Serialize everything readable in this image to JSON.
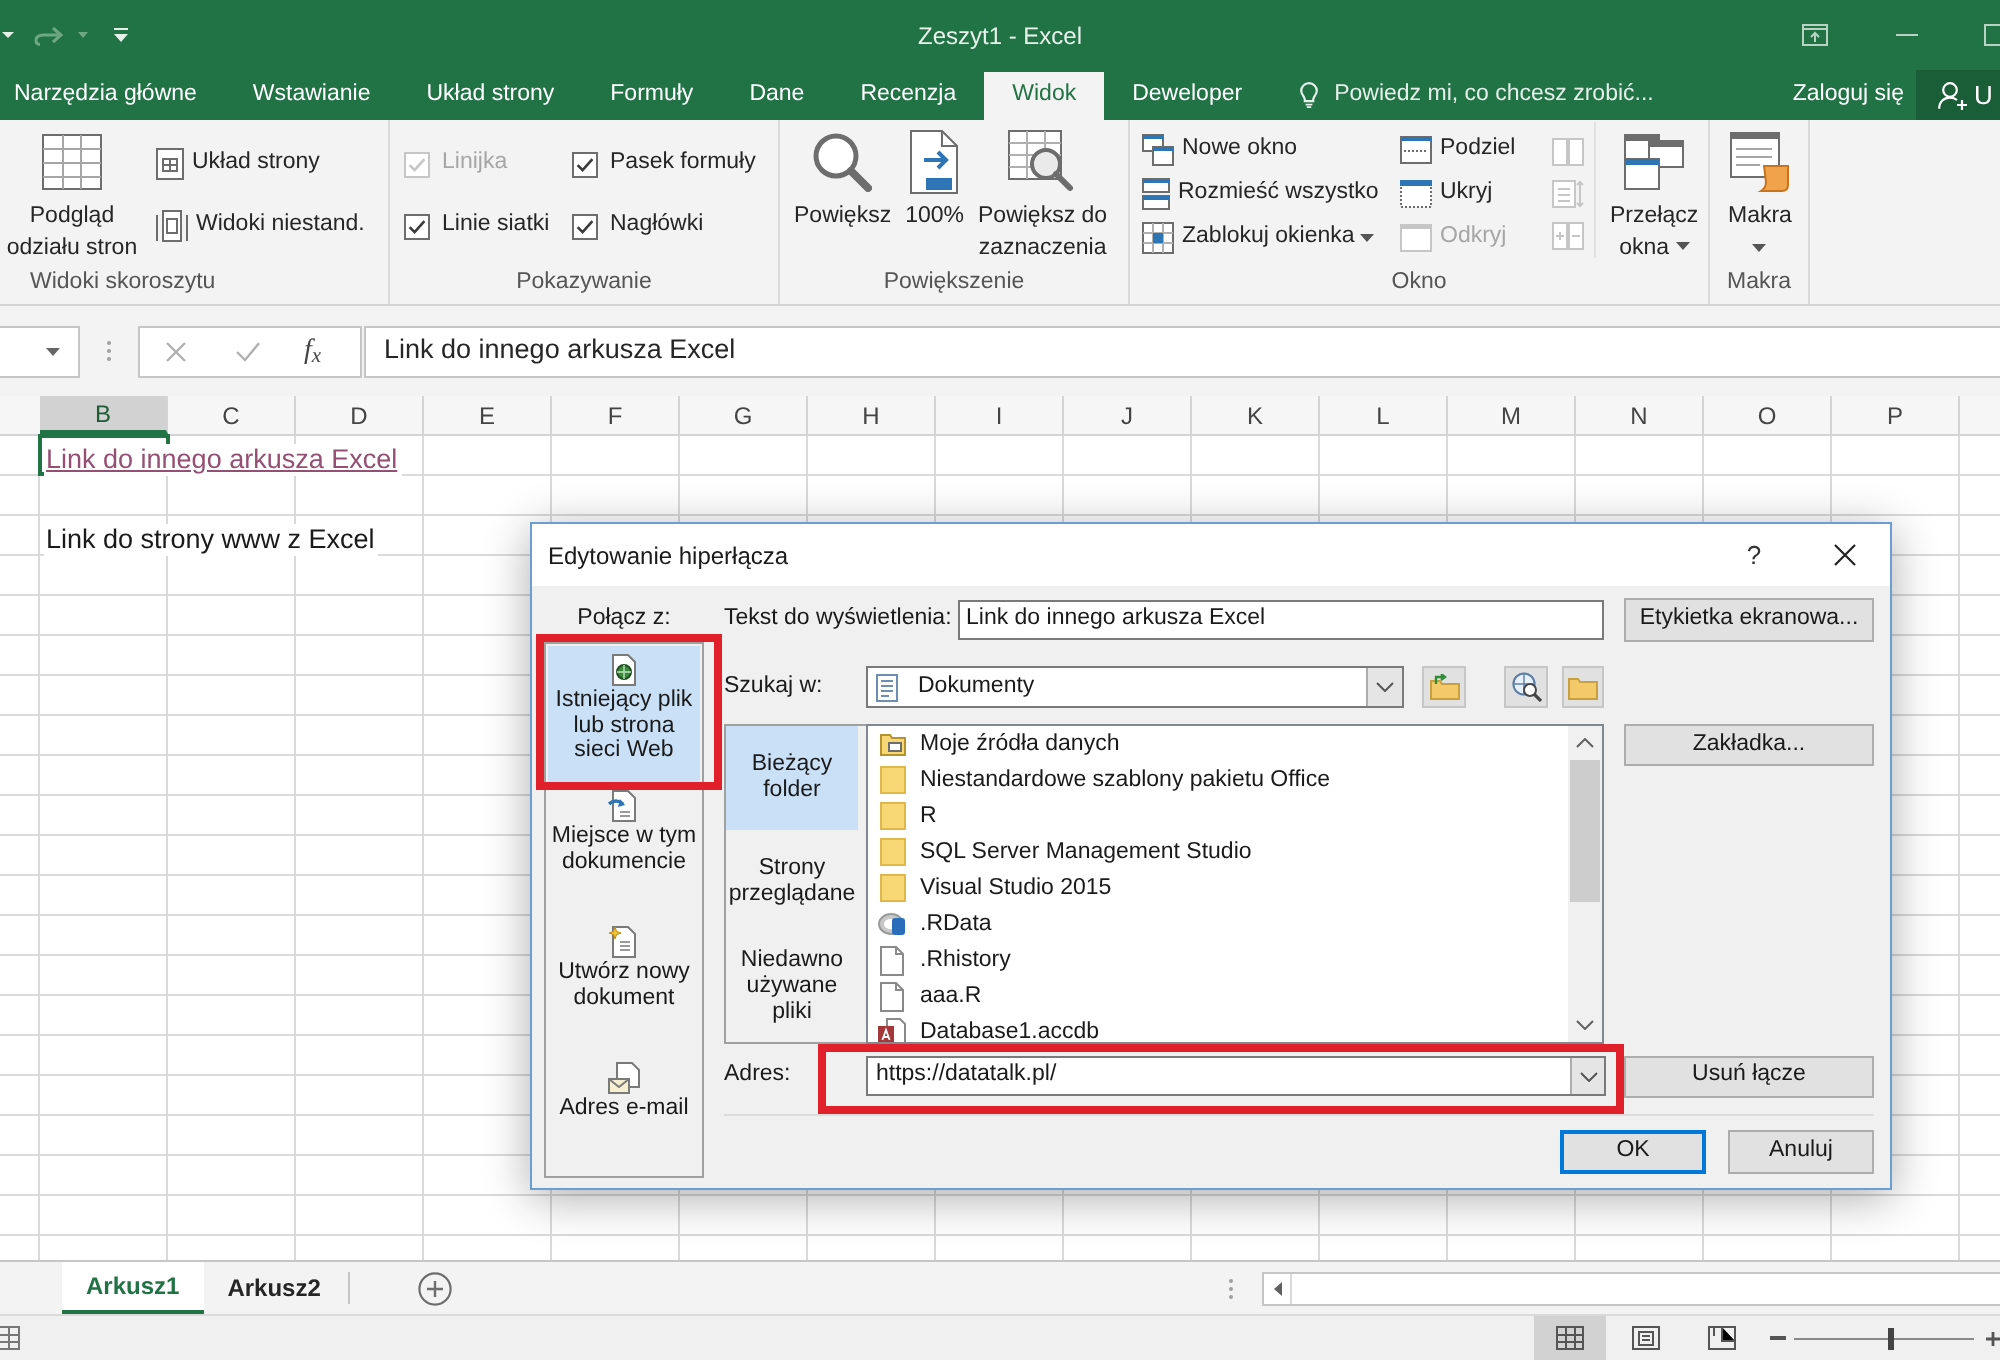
{
  "window": {
    "title": "Zeszyt1 - Excel"
  },
  "ribbon_tabs": [
    {
      "label": "Narzędzia główne",
      "selected": false
    },
    {
      "label": "Wstawianie",
      "selected": false
    },
    {
      "label": "Układ strony",
      "selected": false
    },
    {
      "label": "Formuły",
      "selected": false
    },
    {
      "label": "Dane",
      "selected": false
    },
    {
      "label": "Recenzja",
      "selected": false
    },
    {
      "label": "Widok",
      "selected": true
    },
    {
      "label": "Deweloper",
      "selected": false
    }
  ],
  "tell_me": {
    "label": "Powiedz mi, co chcesz zrobić..."
  },
  "sign_in": {
    "label": "Zaloguj się"
  },
  "share": {
    "label": "U"
  },
  "ribbon_groups": [
    {
      "title": "Widoki skoroszytu",
      "columns": [
        {
          "controls": [
            {
              "kind": "large",
              "label": "Podgląd\nodziału stron",
              "disabled": false,
              "dropdown": false
            }
          ]
        },
        {
          "controls": [
            {
              "kind": "small",
              "label": "Układ strony",
              "disabled": false,
              "dropdown": false
            },
            {
              "kind": "small",
              "label": "Widoki niestand.",
              "disabled": false,
              "dropdown": false
            }
          ]
        }
      ]
    },
    {
      "title": "Pokazywanie",
      "columns": [
        {
          "controls": [
            {
              "kind": "checkbox",
              "label": "Linijka",
              "checked": true,
              "disabled": true
            },
            {
              "kind": "checkbox",
              "label": "Linie siatki",
              "checked": true,
              "disabled": false
            }
          ]
        },
        {
          "controls": [
            {
              "kind": "checkbox",
              "label": "Pasek formuły",
              "checked": true,
              "disabled": false
            },
            {
              "kind": "checkbox",
              "label": "Nagłówki",
              "checked": true,
              "disabled": false
            }
          ]
        }
      ]
    },
    {
      "title": "Powiększenie",
      "columns": [
        {
          "controls": [
            {
              "kind": "large",
              "label": "Powiększ",
              "disabled": false,
              "dropdown": false
            }
          ]
        },
        {
          "controls": [
            {
              "kind": "large",
              "label": "100%",
              "disabled": false,
              "dropdown": false
            }
          ]
        },
        {
          "controls": [
            {
              "kind": "large",
              "label": "Powiększ do\nzaznaczenia",
              "disabled": false,
              "dropdown": false
            }
          ]
        }
      ]
    },
    {
      "title": "Okno",
      "columns": [
        {
          "controls": [
            {
              "kind": "small",
              "label": "Nowe okno",
              "disabled": false,
              "dropdown": false
            },
            {
              "kind": "small",
              "label": "Rozmieść wszystko",
              "disabled": false,
              "dropdown": false
            },
            {
              "kind": "small",
              "label": "Zablokuj okienka",
              "disabled": false,
              "dropdown": true
            }
          ]
        },
        {
          "controls": [
            {
              "kind": "small",
              "label": "Podziel",
              "disabled": false,
              "dropdown": false
            },
            {
              "kind": "small",
              "label": "Ukryj",
              "disabled": false,
              "dropdown": false
            },
            {
              "kind": "small",
              "label": "Odkryj",
              "disabled": true,
              "dropdown": false
            }
          ]
        },
        {
          "controls": [
            {
              "kind": "icon",
              "disabled": true
            },
            {
              "kind": "icon",
              "disabled": true
            },
            {
              "kind": "icon",
              "disabled": true
            }
          ]
        },
        {
          "controls": [
            {
              "kind": "large",
              "label": "Przełącz\nokna",
              "disabled": false,
              "dropdown": true
            }
          ]
        }
      ]
    },
    {
      "title": "Makra",
      "columns": [
        {
          "controls": [
            {
              "kind": "large",
              "label": "Makra",
              "disabled": false,
              "dropdown": true
            }
          ]
        }
      ]
    }
  ],
  "formula_bar": {
    "function_label": "f$_{x}$",
    "value": "Link do innego arkusza Excel"
  },
  "sheet": {
    "columns": [
      {
        "label": "B",
        "selected": true
      },
      {
        "label": "C",
        "selected": false
      },
      {
        "label": "D",
        "selected": false
      },
      {
        "label": "E",
        "selected": false
      },
      {
        "label": "F",
        "selected": false
      },
      {
        "label": "G",
        "selected": false
      },
      {
        "label": "H",
        "selected": false
      },
      {
        "label": "I",
        "selected": false
      },
      {
        "label": "J",
        "selected": false
      },
      {
        "label": "K",
        "selected": false
      },
      {
        "label": "L",
        "selected": false
      },
      {
        "label": "M",
        "selected": false
      },
      {
        "label": "N",
        "selected": false
      },
      {
        "label": "O",
        "selected": false
      },
      {
        "label": "P",
        "selected": false
      }
    ],
    "rows": [
      {
        "kind": "filled",
        "cells": [
          {
            "kind": "hyperlink",
            "text": "Link do innego arkusza Excel",
            "selected": true
          }
        ]
      },
      {
        "kind": "blank"
      },
      {
        "kind": "filled",
        "cells": [
          {
            "kind": "text",
            "text": "Link do strony www z Excel",
            "selected": false
          }
        ]
      }
    ]
  },
  "dialog": {
    "title": "Edytowanie hiperłącza",
    "help": "?",
    "link_to_label": "Połącz z:",
    "link_to": [
      {
        "label": "Istniejący plik\nlub strona\nsieci Web",
        "selected": true,
        "highlighted": true
      },
      {
        "label": "Miejsce w tym\ndokumencie",
        "selected": false,
        "highlighted": false
      },
      {
        "label": "Utwórz nowy\ndokument",
        "selected": false,
        "highlighted": false
      },
      {
        "label": "Adres e-mail",
        "selected": false,
        "highlighted": false
      }
    ],
    "display_text": {
      "label": "Tekst do wyświetlenia:",
      "value": "Link do innego arkusza Excel"
    },
    "screentip_button": {
      "label": "Etykietka ekranowa..."
    },
    "look_in": {
      "label": "Szukaj w:",
      "value": "Dokumenty"
    },
    "browse_tabs": [
      {
        "label": "Bieżący\nfolder",
        "selected": true
      },
      {
        "label": "Strony\nprzeglądane",
        "selected": false
      },
      {
        "label": "Niedawno\nużywane\npliki",
        "selected": false
      }
    ],
    "files": [
      {
        "name": "Moje źródła danych",
        "kind": "special-folder"
      },
      {
        "name": "Niestandardowe szablony pakietu Office",
        "kind": "folder"
      },
      {
        "name": "R",
        "kind": "folder"
      },
      {
        "name": "SQL Server Management Studio",
        "kind": "folder"
      },
      {
        "name": "Visual Studio 2015",
        "kind": "folder"
      },
      {
        "name": ".RData",
        "kind": "r-data"
      },
      {
        "name": ".Rhistory",
        "kind": "file"
      },
      {
        "name": "aaa.R",
        "kind": "file"
      },
      {
        "name": "Database1.accdb",
        "kind": "access"
      }
    ],
    "bookmark_button": {
      "label": "Zakładka..."
    },
    "address": {
      "label": "Adres:",
      "value": "https://datatalk.pl/",
      "highlighted": true
    },
    "remove_link_button": {
      "label": "Usuń łącze"
    },
    "buttons": [
      {
        "label": "OK",
        "default": true
      },
      {
        "label": "Anuluj",
        "default": false
      }
    ]
  },
  "sheet_tabs": [
    {
      "label": "Arkusz1",
      "selected": true
    },
    {
      "label": "Arkusz2",
      "selected": false
    }
  ],
  "status_bar": {
    "view_buttons": [
      {
        "selected": true
      },
      {
        "selected": false
      },
      {
        "selected": false
      }
    ],
    "zoom_slider": {
      "level": 0.53
    }
  }
}
